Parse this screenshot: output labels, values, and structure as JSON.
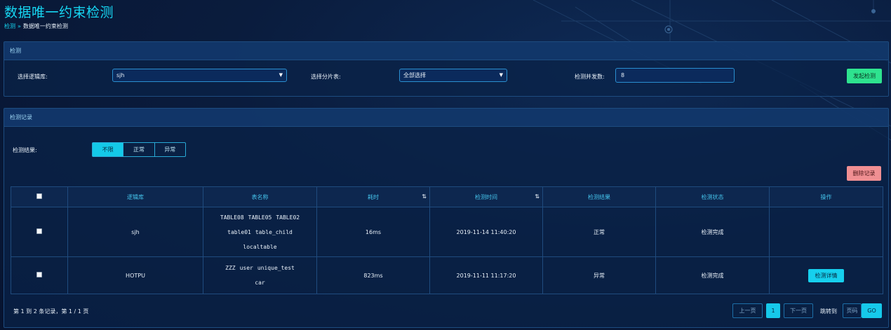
{
  "page": {
    "title": "数据唯一约束检测",
    "breadcrumb": {
      "link": "检测",
      "separator": "»",
      "current": "数据唯一约束检测"
    }
  },
  "detect_panel": {
    "title": "检测",
    "logic_db_label": "选择逻辑库:",
    "logic_db_value": "sjh",
    "shard_table_label": "选择分片表:",
    "shard_table_value": "全部选择",
    "concurrency_label": "检测并发数:",
    "concurrency_value": "8",
    "start_button": "发起检测"
  },
  "record_panel": {
    "title": "检测记录",
    "filter_label": "检测结果:",
    "filter_options": [
      "不限",
      "正常",
      "异常"
    ],
    "filter_selected": "不限",
    "delete_button": "删除记录",
    "columns": [
      "逻辑库",
      "表名称",
      "耗时",
      "检测时间",
      "检测结果",
      "检测状态",
      "操作"
    ],
    "sortable_icon": "sort-icon",
    "rows": [
      {
        "db": "sjh",
        "tables_lines": [
          [
            "TABLE08",
            "TABLE05",
            "TABLE02"
          ],
          [
            "table01",
            "table_child"
          ],
          [
            "localtable"
          ]
        ],
        "duration": "16ms",
        "time": "2019-11-14 11:40:20",
        "result": "正常",
        "status": "检测完成",
        "action": ""
      },
      {
        "db": "HOTPU",
        "tables_lines": [
          [
            "ZZZ",
            "user",
            "unique_test"
          ],
          [
            "car"
          ]
        ],
        "duration": "823ms",
        "time": "2019-11-11 11:17:20",
        "result": "异常",
        "status": "检测完成",
        "action": "检测详情"
      }
    ],
    "pagination": {
      "summary": "第 1 到 2 条记录，第 1 / 1 页",
      "prev": "上一页",
      "current_page": "1",
      "next": "下一页",
      "jump_label": "跳转到",
      "page_input_placeholder": "页码",
      "go": "GO"
    }
  },
  "colors": {
    "accent_cyan": "#16d6f2",
    "success_green": "#2ee38f",
    "danger_pink": "#f08f92",
    "panel_bg": "#0a2248",
    "border": "#1d4c80"
  }
}
